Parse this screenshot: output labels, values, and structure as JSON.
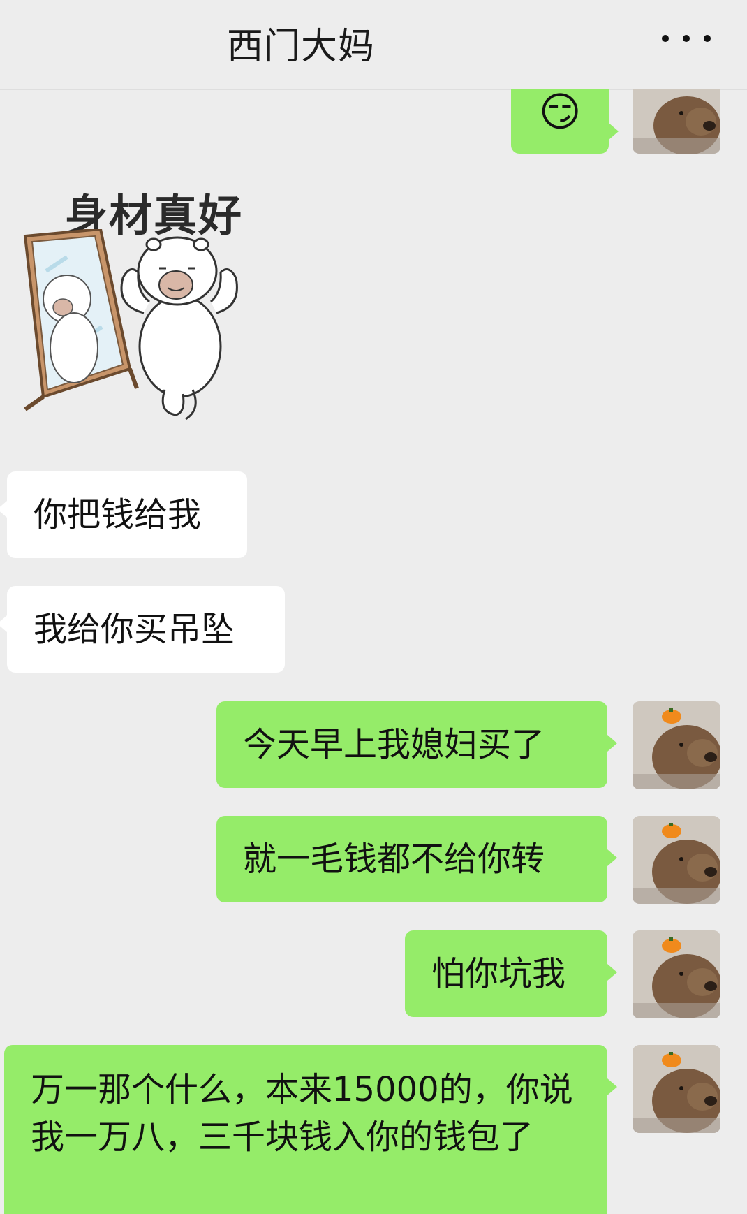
{
  "header": {
    "title": "西门大妈",
    "more_icon": "more-dots-icon"
  },
  "messages": [
    {
      "side": "right",
      "type": "emoji",
      "emoji": "😏"
    },
    {
      "side": "left",
      "type": "sticker",
      "caption": "身材真好"
    },
    {
      "side": "left",
      "type": "text",
      "text": "你把钱给我"
    },
    {
      "side": "left",
      "type": "text",
      "text": "我给你买吊坠"
    },
    {
      "side": "right",
      "type": "text",
      "text": "今天早上我媳妇买了"
    },
    {
      "side": "right",
      "type": "text",
      "text": "就一毛钱都不给你转"
    },
    {
      "side": "right",
      "type": "text",
      "text": "怕你坑我"
    },
    {
      "side": "right",
      "type": "text",
      "text": "万一那个什么，本来15000的，你说我一万八，三千块钱入你的钱包了"
    }
  ],
  "colors": {
    "background": "#ededed",
    "right_bubble": "#95ec69",
    "left_bubble": "#ffffff"
  }
}
